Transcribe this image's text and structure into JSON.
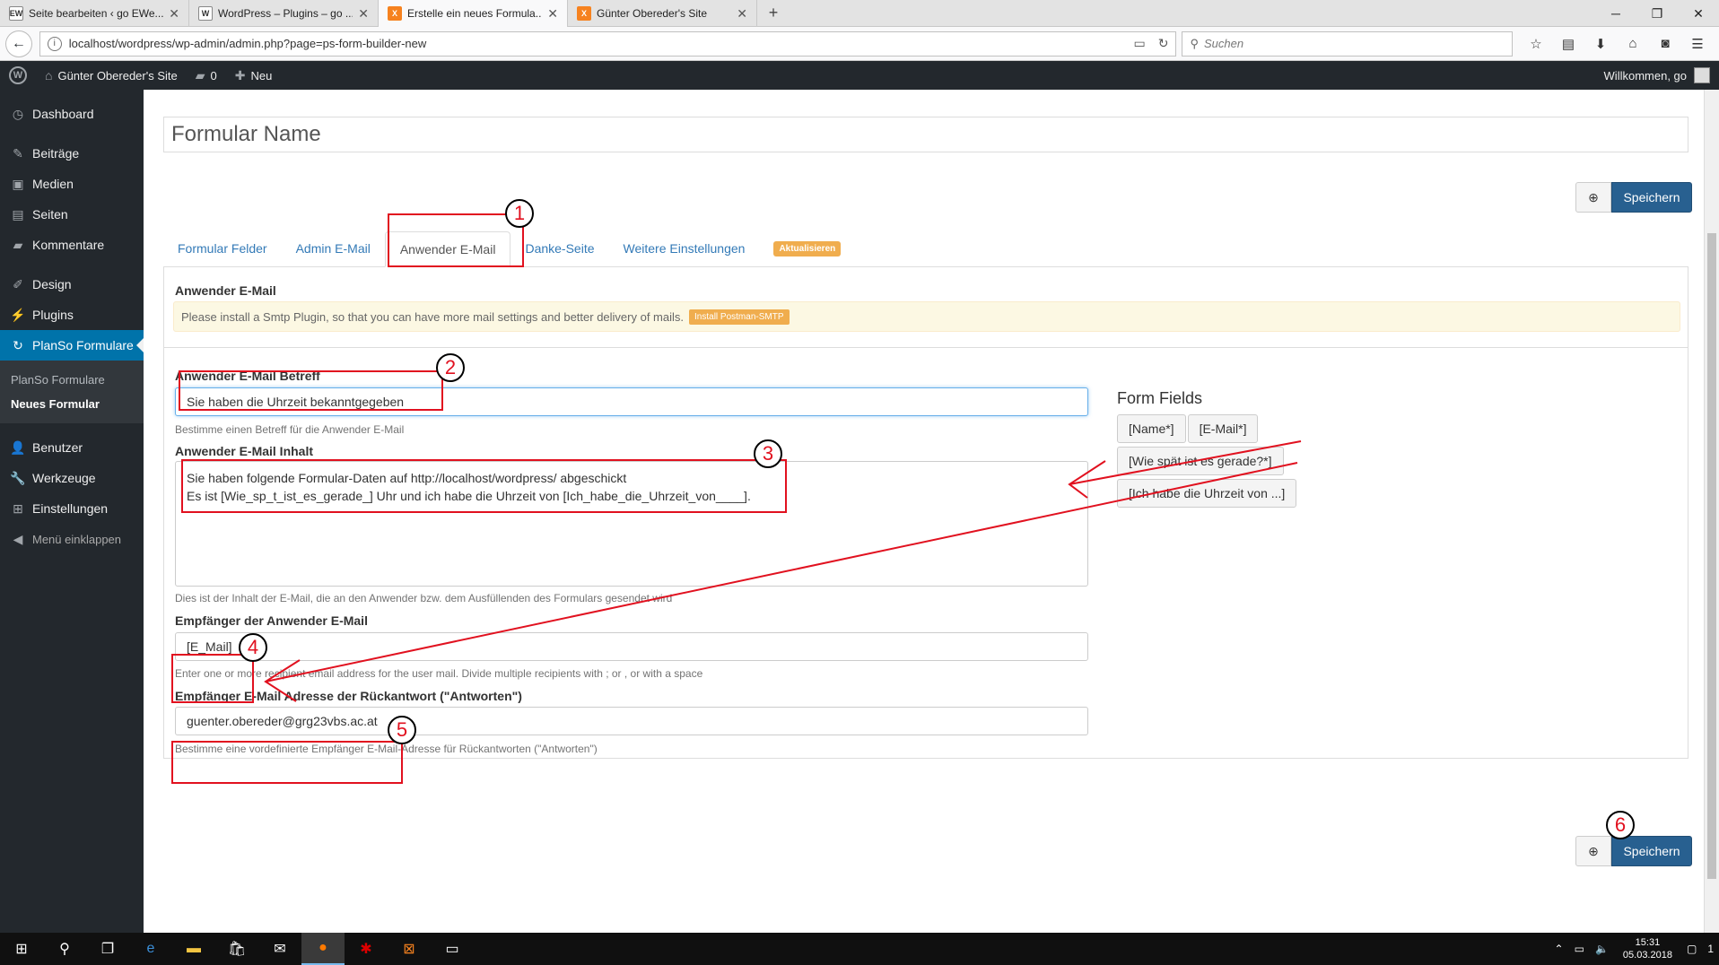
{
  "browser": {
    "tabs": [
      {
        "label": "Seite bearbeiten ‹ go EWe...",
        "icon": "EW"
      },
      {
        "label": "WordPress – Plugins – go ...",
        "icon": "W"
      },
      {
        "label": "Erstelle ein neues Formula...",
        "icon": "X"
      },
      {
        "label": "Günter Obereder's Site",
        "icon": "X"
      }
    ],
    "url": "localhost/wordpress/wp-admin/admin.php?page=ps-form-builder-new",
    "search_placeholder": "Suchen"
  },
  "adminbar": {
    "site_name": "Günter Obereder's Site",
    "comments_count": "0",
    "new_label": "Neu",
    "welcome": "Willkommen, go"
  },
  "sidebar": {
    "items": [
      {
        "label": "Dashboard",
        "icon": "dashboard-icon"
      },
      {
        "label": "Beiträge",
        "icon": "pin-icon"
      },
      {
        "label": "Medien",
        "icon": "media-icon"
      },
      {
        "label": "Seiten",
        "icon": "pages-icon"
      },
      {
        "label": "Kommentare",
        "icon": "comment-icon"
      },
      {
        "label": "Design",
        "icon": "brush-icon"
      },
      {
        "label": "Plugins",
        "icon": "plugin-icon"
      },
      {
        "label": "PlanSo Formulare",
        "icon": "planso-icon"
      },
      {
        "label": "Benutzer",
        "icon": "user-icon"
      },
      {
        "label": "Werkzeuge",
        "icon": "wrench-icon"
      },
      {
        "label": "Einstellungen",
        "icon": "settings-icon"
      },
      {
        "label": "Menü einklappen",
        "icon": "collapse-icon"
      }
    ],
    "submenu": [
      "PlanSo Formulare",
      "Neues Formular"
    ]
  },
  "main": {
    "form_name_placeholder": "Formular Name",
    "save_label": "Speichern",
    "tabs": [
      "Formular Felder",
      "Admin E-Mail",
      "Anwender E-Mail",
      "Danke-Seite",
      "Weitere Einstellungen"
    ],
    "update_badge": "Aktualisieren",
    "panel_title": "Anwender E-Mail",
    "alert_text": "Please install a Smtp Plugin, so that you can have more mail settings and better delivery of mails.",
    "install_button": "Install Postman-SMTP",
    "subject": {
      "label": "Anwender E-Mail Betreff",
      "value": "Sie haben die Uhrzeit bekanntgegeben",
      "help": "Bestimme einen Betreff für die Anwender E-Mail"
    },
    "content": {
      "label": "Anwender E-Mail Inhalt",
      "value": "Sie haben folgende Formular-Daten auf http://localhost/wordpress/ abgeschickt\nEs ist [Wie_sp_t_ist_es_gerade_] Uhr und ich habe die Uhrzeit von [Ich_habe_die_Uhrzeit_von____].",
      "help": "Dies ist der Inhalt der E-Mail, die an den Anwender bzw. dem Ausfüllenden des Formulars gesendet wird"
    },
    "recipient": {
      "label": "Empfänger der Anwender E-Mail",
      "value": "[E_Mail]",
      "help": "Enter one or more recipient email address for the user mail. Divide multiple recipients with ; or , or with a space"
    },
    "reply_to": {
      "label": "Empfänger E-Mail Adresse der Rückantwort (\"Antworten\")",
      "value": "guenter.obereder@grg23vbs.ac.at",
      "help": "Bestimme eine vordefinierte Empfänger E-Mail-Adresse für Rückantworten (\"Antworten\")"
    },
    "form_fields": {
      "title": "Form Fields",
      "buttons": [
        "[Name*]",
        "[E-Mail*]",
        "[Wie spät ist es gerade?*]",
        "[Ich habe die Uhrzeit von ...]"
      ]
    }
  },
  "annotations": [
    "1",
    "2",
    "3",
    "4",
    "5",
    "6"
  ],
  "taskbar": {
    "time": "15:31",
    "date": "05.03.2018",
    "notification_count": "1"
  },
  "colors": {
    "annotation_red": "#e1111f",
    "wp_blue": "#0073aa",
    "save_blue": "#286090",
    "badge_orange": "#f0ad4e"
  }
}
